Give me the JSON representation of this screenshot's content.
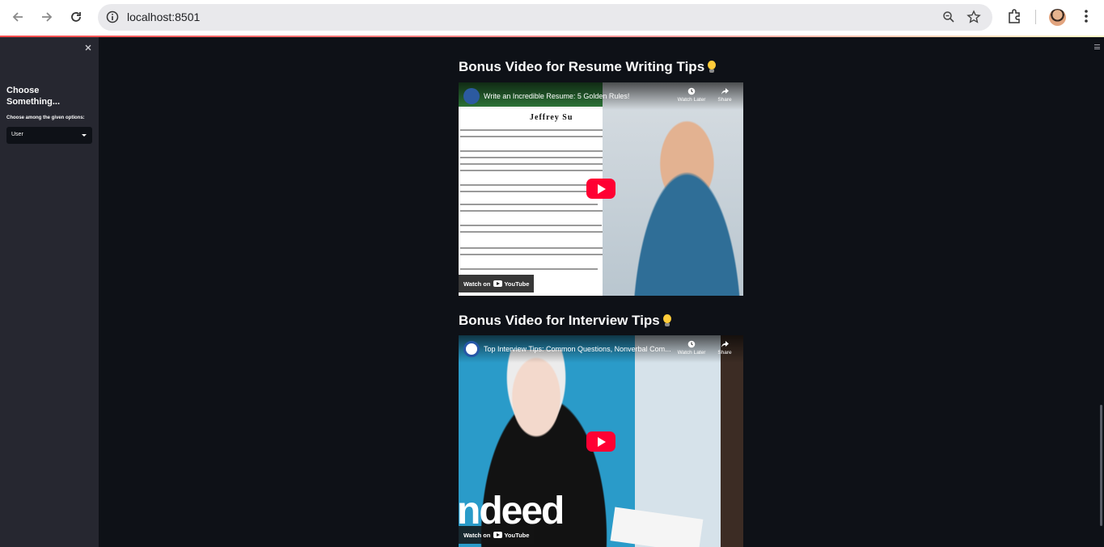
{
  "browser": {
    "url": "localhost:8501"
  },
  "sidebar": {
    "title": "Choose Something...",
    "select_label": "Choose among the given options:",
    "select_value": "User"
  },
  "sections": [
    {
      "heading": "Bonus Video for Resume Writing Tips",
      "video": {
        "title": "Write an Incredible Resume: 5 Golden Rules!",
        "doc_name": "Jeffrey Su",
        "watch_later": "Watch Later",
        "share": "Share",
        "watch_on": "Watch on",
        "youtube": "YouTube"
      }
    },
    {
      "heading": "Bonus Video for Interview Tips",
      "video": {
        "title": "Top Interview Tips: Common Questions, Nonverbal Com...",
        "brand": "ndeed",
        "watch_later": "Watch Later",
        "share": "Share",
        "watch_on": "Watch on",
        "youtube": "YouTube"
      }
    }
  ],
  "colors": {
    "background": "#0e1117",
    "sidebar": "#262730",
    "youtube_red": "#ff0033"
  }
}
